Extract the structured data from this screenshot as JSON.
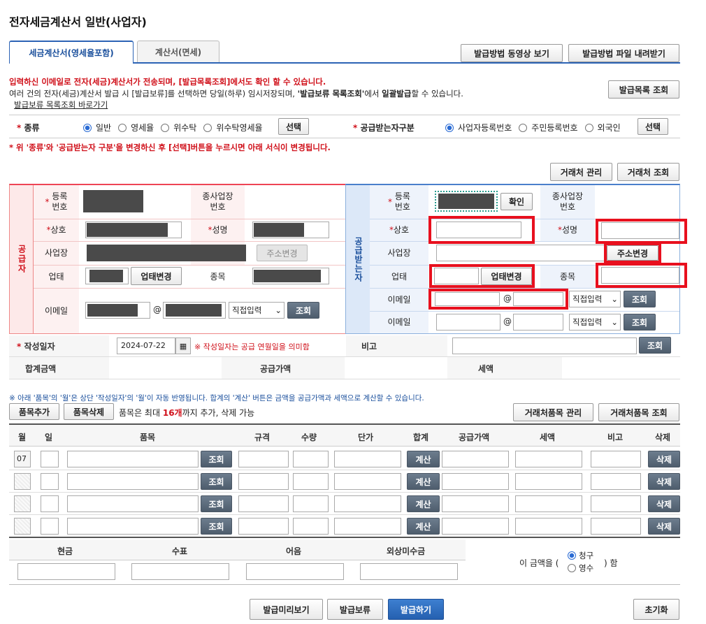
{
  "page_title": "전자세금계산서 일반(사업자)",
  "tabs": [
    {
      "label": "세금계산서(영세율포함)"
    },
    {
      "label": "계산서(면세)"
    }
  ],
  "top_buttons": {
    "video": "발급방법 동영상 보기",
    "file": "발급방법 파일 내려받기",
    "issued_list": "발급목록 조회"
  },
  "notice": {
    "line1": "입력하신 이메일로 전자(세금)계산서가 전송되며, [발급목록조회]에서도 확인 할 수 있습니다.",
    "line2_a": "여러 건의 전자(세금)계산서 발급 시 [발급보류]를 선택하면 당일(하루) 임시저장되며, ",
    "line2_b": "'발급보류 목록조회'",
    "line2_c": "에서 ",
    "line2_d": "일괄발급",
    "line2_e": "할 수 있습니다.",
    "link": "발급보류 목록조회 바로가기"
  },
  "type_row": {
    "label": "종류",
    "options": [
      "일반",
      "영세율",
      "위수탁",
      "위수탁영세율"
    ],
    "selected": "일반",
    "select_btn": "선택",
    "recipient_label": "공급받는자구분",
    "recipient_options": [
      "사업자등록번호",
      "주민등록번호",
      "외국인"
    ],
    "recipient_selected": "사업자등록번호"
  },
  "change_notice": "* 위 '종류'와 '공급받는자 구분'을 변경하신 후 [선택]버튼을 누르시면 아래 서식이 변경됩니다.",
  "partner_buttons": {
    "manage": "거래처 관리",
    "search": "거래처 조회"
  },
  "supplier": {
    "section": "공급자",
    "reg_no": "등록\n번호",
    "sub_biz": "종사업장\n번호",
    "company": "상호",
    "name": "성명",
    "address": "사업장",
    "addr_btn": "주소변경",
    "biz_type": "업태",
    "biz_btn": "업태변경",
    "item": "종목",
    "email": "이메일",
    "email_sel": "직접입력",
    "search_btn": "조회"
  },
  "recipient": {
    "section": "공급받는자",
    "reg_no": "등록\n번호",
    "confirm_btn": "확인",
    "sub_biz": "종사업장\n번호",
    "company": "상호",
    "name": "성명",
    "address": "사업장",
    "addr_btn": "주소변경",
    "biz_type": "업태",
    "biz_btn": "업태변경",
    "item": "종목",
    "email": "이메일",
    "email_sel": "직접입력",
    "search_btn": "조회"
  },
  "date_row": {
    "label": "작성일자",
    "value": "2024-07-22",
    "hint": "※ 작성일자는 공급 연월일을 의미함",
    "remark": "비고",
    "search_btn": "조회"
  },
  "totals": {
    "total": "합계금액",
    "supply": "공급가액",
    "tax": "세액"
  },
  "items_notice": "※ 아래 '품목'의 '월'은 상단 '작성일자'의 '월'이 자동 반영됩니다. 합계의 '계산' 버튼은 금액을 공급가액과 세액으로 계산할 수 있습니다.",
  "item_buttons": {
    "add": "품목추가",
    "delete": "품목삭제",
    "max_a": "품목은 최대 ",
    "max_b": "16개",
    "max_c": "까지 추가, 삭제 가능",
    "manage": "거래처품목 관리",
    "search": "거래처품목 조회"
  },
  "item_table": {
    "headers": [
      "월",
      "일",
      "품목",
      "규격",
      "수량",
      "단가",
      "합계",
      "공급가액",
      "세액",
      "비고",
      "삭제"
    ],
    "month": "07",
    "search_btn": "조회",
    "calc_btn": "계산",
    "delete_btn": "삭제"
  },
  "payment": {
    "headers": [
      "현금",
      "수표",
      "어음",
      "외상미수금"
    ],
    "amount_a": "이 금액을 (",
    "amount_b": ") 함",
    "opt1": "청구",
    "opt2": "영수"
  },
  "bottom_buttons": {
    "preview": "발급미리보기",
    "hold": "발급보류",
    "issue": "발급하기",
    "reset": "초기화"
  }
}
